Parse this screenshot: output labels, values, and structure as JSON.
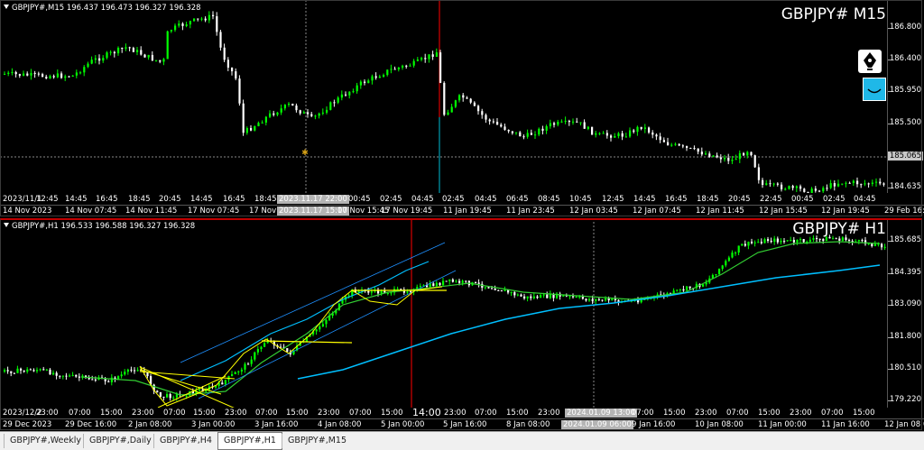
{
  "m15": {
    "info": "GBPJPY#,M15  196.437 196.473 196.327 196.328",
    "title": "GBPJPY# M15",
    "price_labels": [
      "186.800",
      "186.400",
      "185.950",
      "185.500",
      "185.065",
      "184.635"
    ],
    "current_price": "185.065",
    "hour_labels": [
      "2023/11/1",
      "12:45",
      "14:45",
      "16:45",
      "18:45",
      "20:45",
      "14:45",
      "16:45",
      "18:45",
      "00:45",
      "02:45",
      "04:45",
      "02:45",
      "04:45",
      "06:45",
      "08:45",
      "10:45",
      "12:45",
      "14:45",
      "16:45",
      "18:45",
      "20:45",
      "22:45",
      "00:45",
      "02:45",
      "04:45"
    ],
    "crosshair_hour": "2023.11.17 22:00",
    "date_labels": [
      "14 Nov 2023",
      "14 Nov 07:45",
      "14 Nov 11:45",
      "17 Nov 07:45",
      "17 Nov 11:45",
      "17 Nov",
      "17 Nov 15:45",
      "17 Nov 19:45",
      "11 Jan 19:45",
      "11 Jan 23:45",
      "12 Jan 03:45",
      "12 Jan 07:45",
      "12 Jan 11:45",
      "12 Jan 15:45",
      "12 Jan 19:45",
      "29 Feb 16:00"
    ],
    "crosshair_date": "2023.11.17 15:00",
    "top_left_stamp": "2023/11/1"
  },
  "h1": {
    "info": "GBPJPY#,H1  196.533 196.588 196.327 196.328",
    "title": "GBPJPY# H1",
    "price_labels": [
      "185.685",
      "184.395",
      "183.090",
      "181.800",
      "180.510",
      "179.220"
    ],
    "hour_labels": [
      "2023/12/2",
      "23:00",
      "07:00",
      "15:00",
      "23:00",
      "07:00",
      "15:00",
      "23:00",
      "07:00",
      "15:00",
      "23:00",
      "07:00",
      "15:00",
      "23:00",
      "07:00",
      "15:00",
      "23:00",
      "07:00",
      "15:00",
      "23:00",
      "07:00",
      "15:00",
      "23:00",
      "07:00",
      "15:00",
      "23:00"
    ],
    "crosshair_hour": "2024.01.09 13:00",
    "marker_label": "14:00",
    "date_labels": [
      "29 Dec 2023",
      "29 Dec 16:00",
      "2 Jan 08:00",
      "3 Jan 00:00",
      "3 Jan 16:00",
      "4 Jan 08:00",
      "5 Jan 00:00",
      "5 Jan 16:00",
      "8 Jan 08:00",
      "9 Jan 16:00",
      "10 Jan 08:00",
      "11 Jan 00:00",
      "11 Jan 16:00",
      "12 Jan 08:00"
    ],
    "crosshair_date": "2024.01.09 06:00"
  },
  "icons": {
    "pen": "fountain-pen-icon",
    "smile": "smile-icon"
  },
  "colors": {
    "bull": "#00ff00",
    "bear": "#ffffff",
    "ma_green": "#32cd32",
    "ma_cyan": "#00bfff",
    "fan_yellow": "#ffff00",
    "vline_red": "#ff0000",
    "vline_cyan": "#00bcd4"
  },
  "tabs": [
    {
      "label": "GBPJPY#,Weekly",
      "active": false
    },
    {
      "label": "GBPJPY#,Daily",
      "active": false
    },
    {
      "label": "GBPJPY#,H4",
      "active": false
    },
    {
      "label": "GBPJPY#,H1",
      "active": true
    },
    {
      "label": "GBPJPY#,M15",
      "active": false
    }
  ]
}
